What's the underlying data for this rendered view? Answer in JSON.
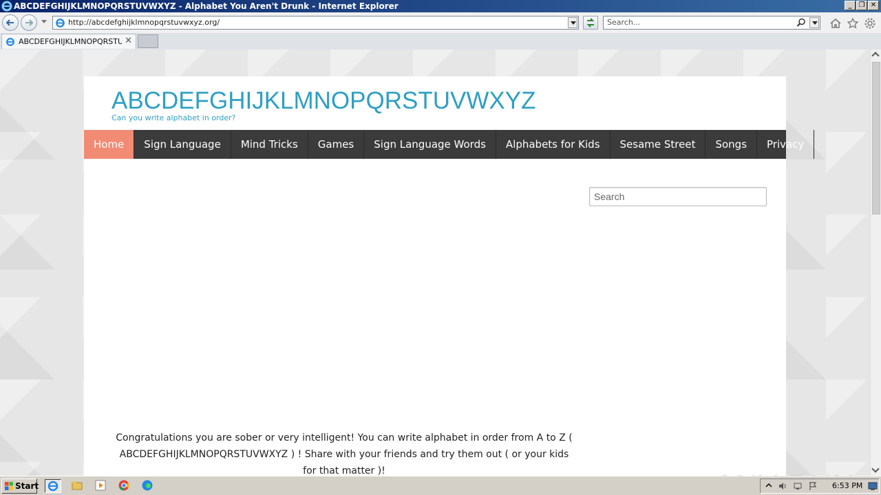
{
  "window": {
    "title": "ABCDEFGHIJKLMNOPQRSTUVWXYZ - Alphabet You Aren't Drunk - Internet Explorer",
    "buttons": {
      "minimize": "_",
      "restore": "❐",
      "close": "✕"
    }
  },
  "browser": {
    "address_url": "http://abcdefghijklmnopqrstuvwxyz.org/",
    "search_placeholder": "Search...",
    "tab_label": "ABCDEFGHIJKLMNOPQRSTU...",
    "tab_close": "✕"
  },
  "site": {
    "title": "ABCDEFGHIJKLMNOPQRSTUVWXYZ",
    "tagline": "Can you write alphabet in order?",
    "nav": [
      "Home",
      "Sign Language",
      "Mind Tricks",
      "Games",
      "Sign Language Words",
      "Alphabets for Kids",
      "Sesame Street",
      "Songs",
      "Privacy"
    ],
    "search_placeholder": "Search",
    "message": "Congratulations you are sober or very intelligent! You can write alphabet in order from A to Z ( ABCDEFGHIJKLMNOPQRSTUVWXYZ ) ! Share with your friends and try them out ( or your kids for that matter )!",
    "accent_color": "#2e9fc4",
    "active_nav_color": "#f28b73",
    "nav_bg_color": "#3b3b3b"
  },
  "watermark": "ANY RUN",
  "taskbar": {
    "start_label": "Start",
    "clock": "6:53 PM"
  }
}
